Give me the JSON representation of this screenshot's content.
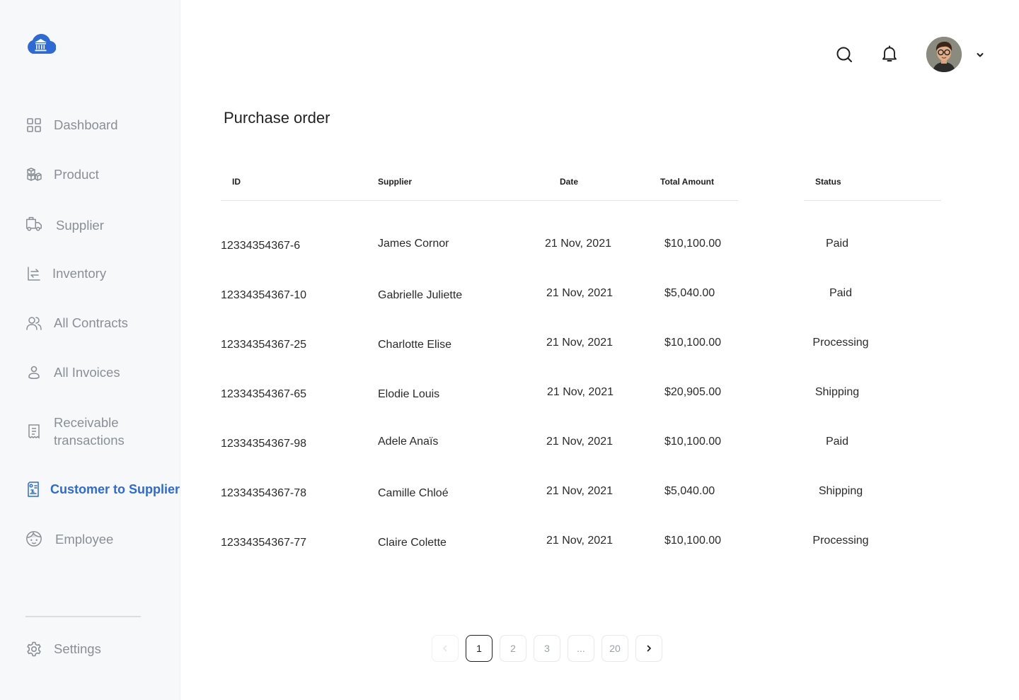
{
  "colors": {
    "accent": "#2d6ad6",
    "nav_text": "#8a8f96",
    "sidebar_bg": "#f7f8f9"
  },
  "logo": {
    "icon": "bank-cloud-icon"
  },
  "sidebar": {
    "items": [
      {
        "label": "Dashboard",
        "icon": "grid-icon"
      },
      {
        "label": "Product",
        "icon": "boxes-icon"
      },
      {
        "label": "Supplier",
        "icon": "truck-icon"
      },
      {
        "label": "Inventory",
        "icon": "inventory-icon"
      },
      {
        "label": "All Contracts",
        "icon": "users-icon"
      },
      {
        "label": "All Invoices",
        "icon": "user-icon"
      },
      {
        "label": "Receivable transactions",
        "icon": "receipt-icon"
      },
      {
        "label": "Customer to Supplier",
        "icon": "document-transfer-icon",
        "active": true
      },
      {
        "label": "Employee",
        "icon": "face-icon"
      }
    ],
    "settings_label": "Settings"
  },
  "header": {
    "search_icon": "search-icon",
    "notification_icon": "bell-icon",
    "avatar_menu_icon": "chevron-down-icon"
  },
  "page": {
    "title": "Purchase order"
  },
  "table": {
    "columns": {
      "id": "ID",
      "supplier": "Supplier",
      "date": "Date",
      "amount": "Total Amount",
      "status": "Status"
    },
    "rows": [
      {
        "id": "12334354367-6",
        "supplier": "James Cornor",
        "date": "21 Nov, 2021",
        "amount": "$10,100.00",
        "status": "Paid"
      },
      {
        "id": "12334354367-10",
        "supplier": "Gabrielle Juliette",
        "date": "21 Nov, 2021",
        "amount": "$5,040.00",
        "status": "Paid"
      },
      {
        "id": "12334354367-25",
        "supplier": "Charlotte Elise",
        "date": "21 Nov, 2021",
        "amount": "$10,100.00",
        "status": "Processing"
      },
      {
        "id": "12334354367-65",
        "supplier": "Elodie Louis",
        "date": "21 Nov, 2021",
        "amount": "$20,905.00",
        "status": "Shipping"
      },
      {
        "id": "12334354367-98",
        "supplier": "Adele Anaïs",
        "date": "21 Nov, 2021",
        "amount": "$10,100.00",
        "status": "Paid"
      },
      {
        "id": "12334354367-78",
        "supplier": "Camille Chloé",
        "date": "21 Nov, 2021",
        "amount": "$5,040.00",
        "status": "Shipping"
      },
      {
        "id": "12334354367-77",
        "supplier": "Claire Colette",
        "date": "21 Nov, 2021",
        "amount": "$10,100.00",
        "status": "Processing"
      }
    ]
  },
  "pagination": {
    "prev_icon": "chevron-left-icon",
    "next_icon": "chevron-right-icon",
    "pages": [
      "1",
      "2",
      "3",
      "...",
      "20"
    ],
    "current": "1"
  }
}
